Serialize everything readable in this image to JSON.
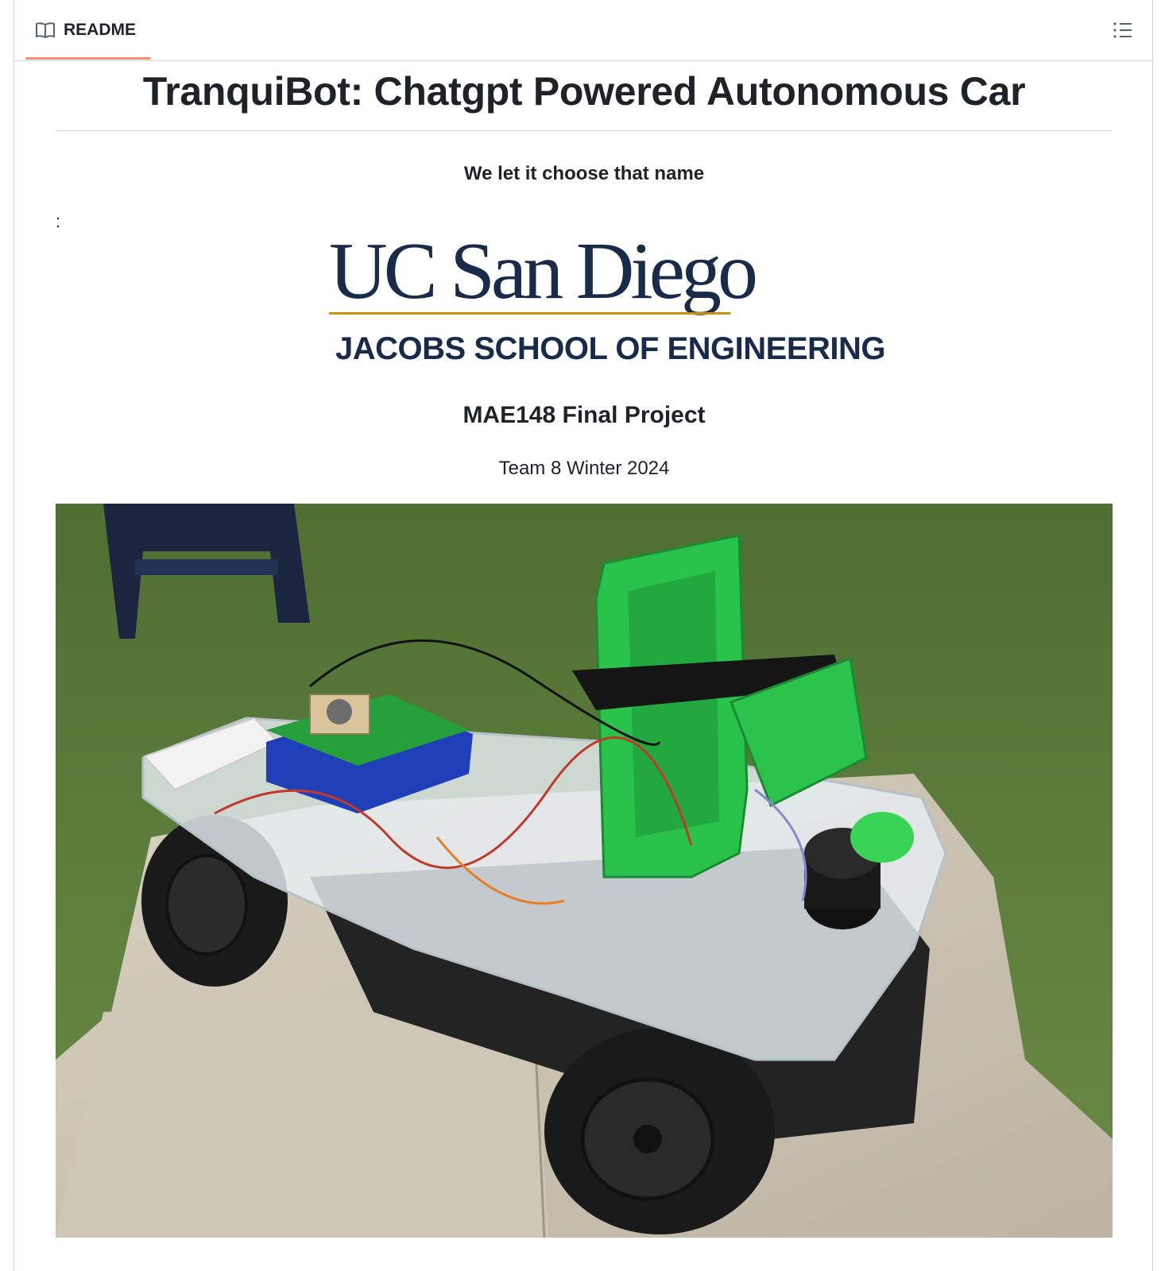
{
  "tab": {
    "label": "README",
    "icon": "book-icon"
  },
  "toolbar": {
    "toc_icon": "list-icon"
  },
  "readme": {
    "title": "TranquiBot: Chatgpt Powered Autonomous Car",
    "subtitle": "We let it choose that name",
    "colon": ":",
    "logo": {
      "main": "UC San Diego",
      "sub": "JACOBS SCHOOL OF ENGINEERING"
    },
    "project": "MAE148 Final Project",
    "team": "Team 8 Winter 2024"
  },
  "colors": {
    "tab_underline": "#fd8c73",
    "ucsd_navy": "#182b49",
    "ucsd_gold": "#c69214"
  }
}
